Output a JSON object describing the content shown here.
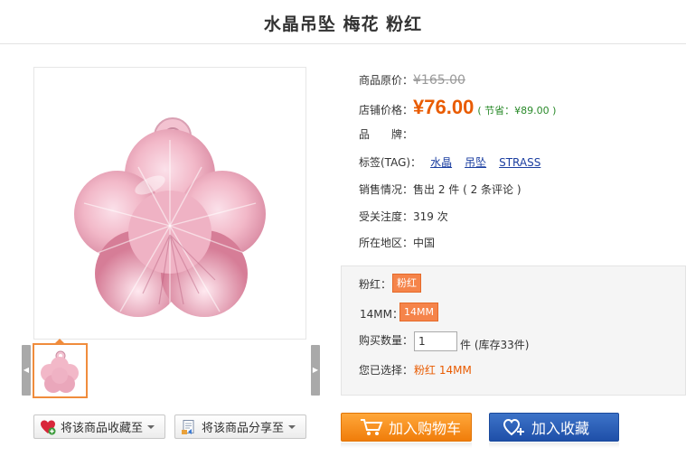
{
  "product": {
    "title": "水晶吊坠 梅花 粉红"
  },
  "info": {
    "orig_price_label": "商品原价：",
    "orig_price": "¥165.00",
    "shop_price_label": "店铺价格：",
    "shop_price": "¥76.00",
    "saving": "( 节省：¥89.00 )",
    "brand_label": "品　　牌：",
    "tags_label": "标签(TAG)：",
    "tags": [
      "水晶",
      "吊坠",
      "STRASS"
    ],
    "sales_label": "销售情况：",
    "sales_value": "售出 2 件 ( 2 条评论 )",
    "attention_label": "受关注度：",
    "attention_value": "319 次",
    "region_label": "所在地区：",
    "region_value": "中国"
  },
  "options": {
    "color_label": "粉红：",
    "color_value": "粉红",
    "size_label": "14MM：",
    "size_value": "14MM",
    "qty_label": "购买数量：",
    "qty_value": "1",
    "qty_unit": "件 (库存33件)",
    "selected_label": "您已选择：",
    "selected_value": "粉红  14MM"
  },
  "actions": {
    "collect_to": "将该商品收藏至",
    "share_to": "将该商品分享至",
    "add_to_cart": "加入购物车",
    "add_to_favorites": "加入收藏"
  },
  "colors": {
    "price": "#e95b00",
    "saving": "#2a8a2a",
    "chip": "#f5844a",
    "cart_button": "#f5901e",
    "fav_button": "#2a5cb5",
    "thumb_border": "#f08c3c"
  },
  "icons": {
    "arrow_left": "chevron-left-icon",
    "arrow_right": "chevron-right-icon",
    "collect": "heart-add-icon",
    "share": "share-page-icon",
    "cart": "shopping-cart-icon",
    "favorite": "heart-plus-icon"
  }
}
